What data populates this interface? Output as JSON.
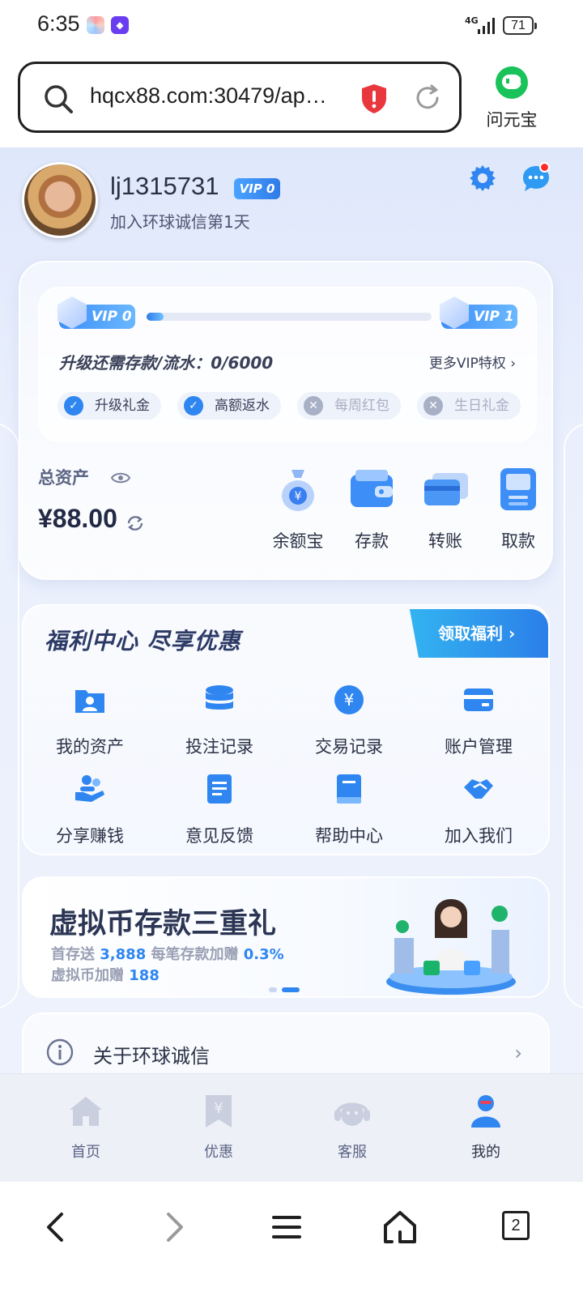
{
  "status": {
    "time": "6:35",
    "network": "4G",
    "battery": "71"
  },
  "browser": {
    "url": "hqcx88.com:30479/ap…",
    "assistant_label": "问元宝",
    "tab_count": "2"
  },
  "profile": {
    "username": "lj1315731",
    "vip_level": "VIP 0",
    "join_text": "加入环球诚信第1天"
  },
  "vip": {
    "current": "VIP 0",
    "next": "VIP 1",
    "progress": 0.06,
    "upgrade_text": "升级还需存款/流水：0/6000",
    "more_link": "更多VIP特权 ›",
    "perks": [
      {
        "label": "升级礼金",
        "enabled": true
      },
      {
        "label": "高额返水",
        "enabled": true
      },
      {
        "label": "每周红包",
        "enabled": false
      },
      {
        "label": "生日礼金",
        "enabled": false
      }
    ]
  },
  "assets": {
    "label": "总资产",
    "balance": "¥88.00",
    "actions": [
      {
        "label": "余额宝",
        "icon": "money-bag-icon"
      },
      {
        "label": "存款",
        "icon": "wallet-icon"
      },
      {
        "label": "转账",
        "icon": "transfer-card-icon"
      },
      {
        "label": "取款",
        "icon": "atm-icon"
      }
    ]
  },
  "welfare": {
    "title": "福利中心  尽享优惠",
    "claim_button": "领取福利 ›",
    "items": [
      {
        "label": "我的资产",
        "icon": "user-folder-icon"
      },
      {
        "label": "投注记录",
        "icon": "database-icon"
      },
      {
        "label": "交易记录",
        "icon": "yen-coin-icon"
      },
      {
        "label": "账户管理",
        "icon": "card-icon"
      },
      {
        "label": "分享赚钱",
        "icon": "share-hand-icon"
      },
      {
        "label": "意见反馈",
        "icon": "document-icon"
      },
      {
        "label": "帮助中心",
        "icon": "book-icon"
      },
      {
        "label": "加入我们",
        "icon": "handshake-icon"
      }
    ]
  },
  "banner": {
    "title": "虚拟币存款三重礼",
    "line1_a": "首存送 ",
    "line1_b": "3,888",
    "line1_c": " 每笔存款加赠 ",
    "line1_d": "0.3%",
    "line2_a": "虚拟币加赠 ",
    "line2_b": "188"
  },
  "about": {
    "label": "关于环球诚信",
    "arrow": "›"
  },
  "tabs": [
    {
      "label": "首页",
      "icon": "home-icon"
    },
    {
      "label": "优惠",
      "icon": "yen-bookmark-icon"
    },
    {
      "label": "客服",
      "icon": "headset-icon"
    },
    {
      "label": "我的",
      "icon": "user-icon"
    }
  ],
  "colors": {
    "accent": "#2f86f0",
    "page_bg": "#e9effc",
    "badge_red": "#ff2d2d"
  }
}
